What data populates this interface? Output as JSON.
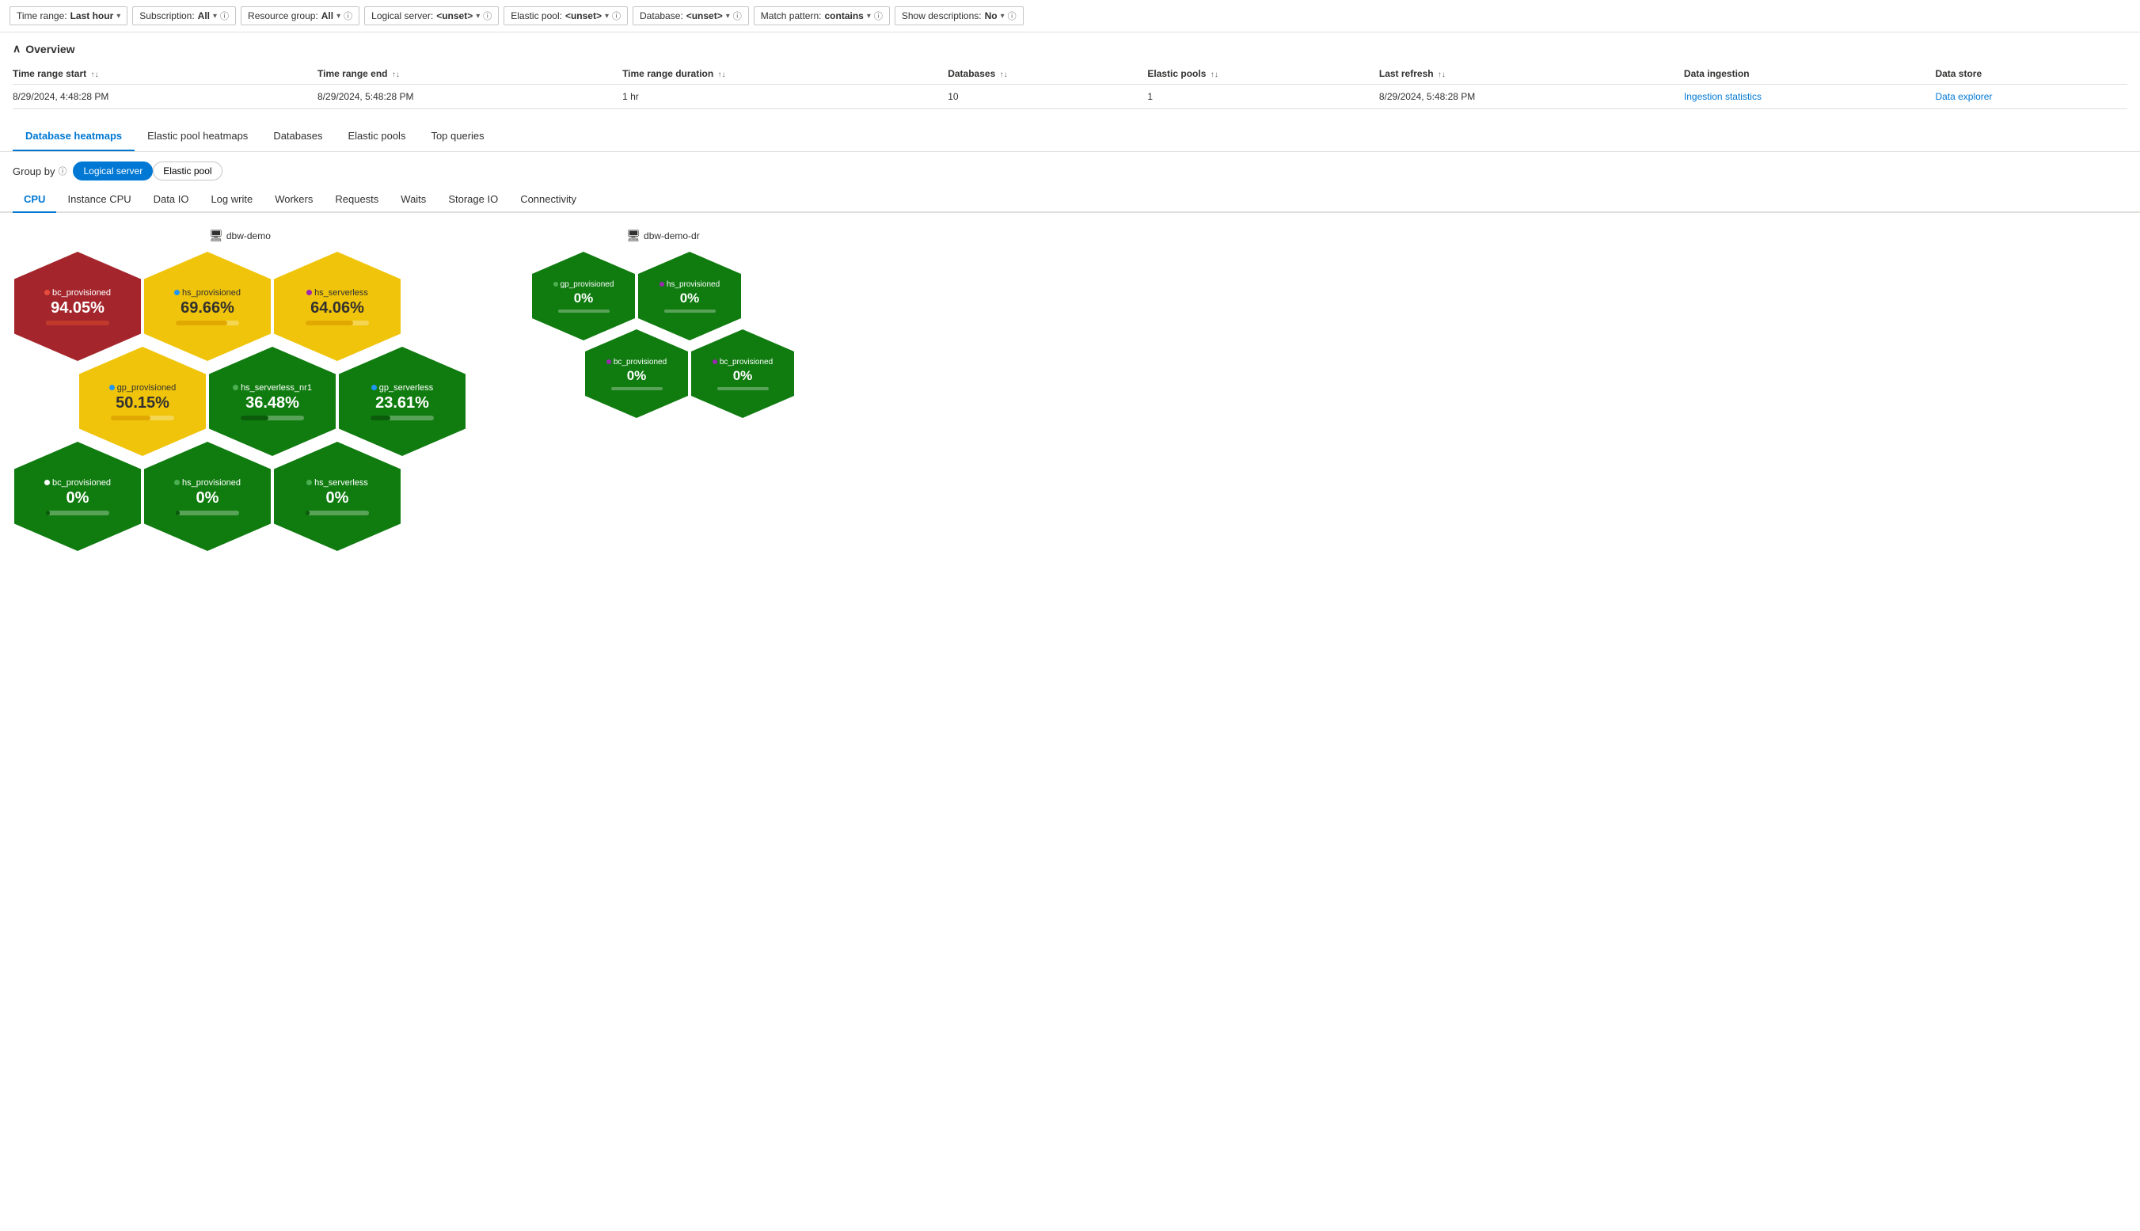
{
  "filterBar": {
    "timeRange": {
      "label": "Time range:",
      "value": "Last hour"
    },
    "subscription": {
      "label": "Subscription:",
      "value": "All"
    },
    "resourceGroup": {
      "label": "Resource group:",
      "value": "All"
    },
    "logicalServer": {
      "label": "Logical server:",
      "value": "<unset>"
    },
    "elasticPool": {
      "label": "Elastic pool:",
      "value": "<unset>"
    },
    "database": {
      "label": "Database:",
      "value": "<unset>"
    },
    "matchPattern": {
      "label": "Match pattern:",
      "value": "contains"
    },
    "showDescriptions": {
      "label": "Show descriptions:",
      "value": "No"
    }
  },
  "overview": {
    "title": "Overview",
    "table": {
      "headers": [
        {
          "label": "Time range start",
          "sortable": true
        },
        {
          "label": "Time range end",
          "sortable": true
        },
        {
          "label": "Time range duration",
          "sortable": true
        },
        {
          "label": "Databases",
          "sortable": true
        },
        {
          "label": "Elastic pools",
          "sortable": true
        },
        {
          "label": "Last refresh",
          "sortable": true
        },
        {
          "label": "Data ingestion",
          "sortable": false
        },
        {
          "label": "Data store",
          "sortable": false
        }
      ],
      "row": {
        "timeStart": "8/29/2024, 4:48:28 PM",
        "timeEnd": "8/29/2024, 5:48:28 PM",
        "duration": "1 hr",
        "databases": "10",
        "elasticPools": "1",
        "lastRefresh": "8/29/2024, 5:48:28 PM",
        "dataIngestion": "Ingestion statistics",
        "dataStore": "Data explorer"
      }
    }
  },
  "mainTabs": [
    "Database heatmaps",
    "Elastic pool heatmaps",
    "Databases",
    "Elastic pools",
    "Top queries"
  ],
  "activeMainTab": "Database heatmaps",
  "groupBy": {
    "label": "Group by",
    "options": [
      "Logical server",
      "Elastic pool"
    ],
    "active": "Logical server"
  },
  "subTabs": [
    "CPU",
    "Instance CPU",
    "Data IO",
    "Log write",
    "Workers",
    "Requests",
    "Waits",
    "Storage IO",
    "Connectivity"
  ],
  "activeSubTab": "CPU",
  "clusters": [
    {
      "name": "dbw-demo",
      "rows": [
        {
          "offset": false,
          "hexes": [
            {
              "color": "red",
              "db": "bc_provisioned",
              "dotColor": "#e74c3c",
              "value": "94.05%",
              "barFill": "#c0392b",
              "barWidth": 80
            },
            {
              "color": "yellow",
              "db": "hs_provisioned",
              "dotColor": "#2196F3",
              "value": "69.66%",
              "barFill": "#e0a800",
              "barWidth": 65
            },
            {
              "color": "yellow",
              "db": "hs_serverless",
              "dotColor": "#9C27B0",
              "value": "64.06%",
              "barFill": "#e0a800",
              "barWidth": 60
            }
          ]
        },
        {
          "offset": true,
          "hexes": [
            {
              "color": "yellow",
              "db": "gp_provisioned",
              "dotColor": "#2196F3",
              "value": "50.15%",
              "barFill": "#e0a800",
              "barWidth": 50
            },
            {
              "color": "green",
              "db": "hs_serverless_nr1",
              "dotColor": "#4CAF50",
              "value": "36.48%",
              "barFill": "#0a5c0a",
              "barWidth": 35
            },
            {
              "color": "green",
              "db": "gp_serverless",
              "dotColor": "#2196F3",
              "value": "23.61%",
              "barFill": "#0a5c0a",
              "barWidth": 25
            }
          ]
        },
        {
          "offset": false,
          "hexes": [
            {
              "color": "green",
              "db": "bc_provisioned",
              "dotColor": "#ffffff",
              "value": "0%",
              "barFill": "#0a5c0a",
              "barWidth": 5
            },
            {
              "color": "green",
              "db": "hs_provisioned",
              "dotColor": "#4CAF50",
              "value": "0%",
              "barFill": "#0a5c0a",
              "barWidth": 5
            },
            {
              "color": "green",
              "db": "hs_serverless",
              "dotColor": "#4CAF50",
              "value": "0%",
              "barFill": "#0a5c0a",
              "barWidth": 5
            }
          ]
        }
      ]
    },
    {
      "name": "dbw-demo-dr",
      "rows": [
        {
          "offset": false,
          "hexes": [
            {
              "db": "gp_provisioned",
              "dotColor": "#4CAF50",
              "value": "0%"
            },
            {
              "db": "hs_provisioned",
              "dotColor": "#9C27B0",
              "value": "0%"
            }
          ]
        },
        {
          "offset": true,
          "hexes": [
            {
              "db": "bc_provisioned",
              "dotColor": "#9C27B0",
              "value": "0%"
            },
            {
              "db": "bc_provisioned",
              "dotColor": "#9C27B0",
              "value": "0%"
            }
          ]
        }
      ]
    }
  ]
}
